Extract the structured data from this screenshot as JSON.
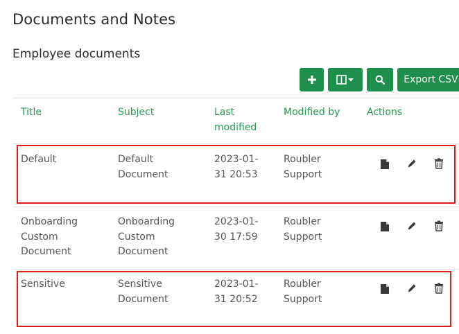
{
  "page_title": "Documents and Notes",
  "section_title": "Employee documents",
  "toolbar": {
    "add_icon": "plus-icon",
    "columns_icon": "columns-dropdown-icon",
    "search_icon": "search-icon",
    "export_label": "Export CSV"
  },
  "table": {
    "headers": [
      "Title",
      "Subject",
      "Last modified",
      "Modified by",
      "Actions"
    ],
    "header_lines": {
      "title": "Title",
      "subject": "Subject",
      "modified_1": "Last",
      "modified_2": "modified",
      "by": "Modified by",
      "actions": "Actions"
    },
    "rows": [
      {
        "title": [
          "Default"
        ],
        "subject": [
          "Default",
          "Document"
        ],
        "modified": [
          "2023-01-",
          "31 20:53"
        ],
        "by": [
          "Roubler",
          "Support"
        ],
        "highlighted": true
      },
      {
        "title": [
          "Onboarding",
          "Custom",
          "Document"
        ],
        "subject": [
          "Onboarding",
          "Custom",
          "Document"
        ],
        "modified": [
          "2023-01-",
          "30 17:59"
        ],
        "by": [
          "Roubler",
          "Support"
        ],
        "highlighted": false
      },
      {
        "title": [
          "Sensitive"
        ],
        "subject": [
          "Sensitive",
          "Document"
        ],
        "modified": [
          "2023-01-",
          "31 20:52"
        ],
        "by": [
          "Roubler",
          "Support"
        ],
        "highlighted": true
      }
    ],
    "action_icons": [
      "document-icon",
      "pencil-icon",
      "trash-icon"
    ]
  },
  "colors": {
    "accent": "#1f8f4e",
    "header_text": "#2a9a55",
    "highlight": "#e01b1b"
  }
}
